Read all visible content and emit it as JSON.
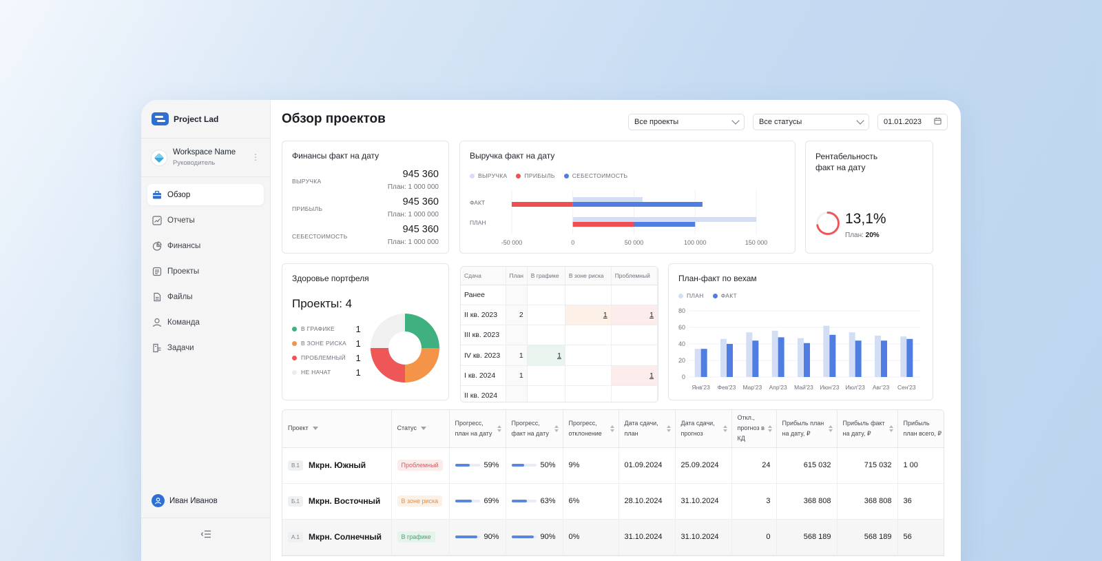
{
  "brand": {
    "name": "Project Lad"
  },
  "workspace": {
    "name": "Workspace Name",
    "role": "Руководитель"
  },
  "nav": [
    {
      "label": "Обзор",
      "icon": "briefcase-icon",
      "active": true
    },
    {
      "label": "Отчеты",
      "icon": "chart-line-icon"
    },
    {
      "label": "Финансы",
      "icon": "pie-chart-icon"
    },
    {
      "label": "Проекты",
      "icon": "document-icon"
    },
    {
      "label": "Файлы",
      "icon": "file-icon"
    },
    {
      "label": "Команда",
      "icon": "user-icon"
    },
    {
      "label": "Задачи",
      "icon": "tasks-icon"
    }
  ],
  "user": {
    "name": "Иван Иванов"
  },
  "page": {
    "title": "Обзор проектов"
  },
  "filters": {
    "projects": "Все проекты",
    "statuses": "Все статусы",
    "date": "01.01.2023"
  },
  "finance": {
    "title": "Финансы факт на дату",
    "rows": [
      {
        "label": "ВЫРУЧКА",
        "value": "945 360",
        "plan": "План: 1 000 000"
      },
      {
        "label": "ПРИБЫЛЬ",
        "value": "945 360",
        "plan": "План: 1 000 000"
      },
      {
        "label": "СЕБЕСТОИМОСТЬ",
        "value": "945 360",
        "plan": "План: 1 000 000"
      }
    ]
  },
  "revenue": {
    "title": "Выручка факт на дату",
    "legend": [
      "ВЫРУЧКА",
      "ПРИБЫЛЬ",
      "СЕБЕСТОИМОСТЬ"
    ],
    "row_labels": [
      "ФАКТ",
      "ПЛАН"
    ],
    "ticks": [
      "-50 000",
      "0",
      "50 000",
      "100 000",
      "150 000"
    ]
  },
  "profitability": {
    "title1": "Рентабельность",
    "title2": "факт на дату",
    "value": "13,1%",
    "plan_label": "План:",
    "plan_value": "20%",
    "fraction": 0.131
  },
  "health": {
    "title": "Здоровье портфеля",
    "total": "Проекты: 4",
    "items": [
      {
        "label": "В ГРАФИКЕ",
        "count": "1",
        "color": "#3fb07f"
      },
      {
        "label": "В ЗОНЕ РИСКА",
        "count": "1",
        "color": "#f39449"
      },
      {
        "label": "ПРОБЛЕМНЫЙ",
        "count": "1",
        "color": "#ef5658"
      },
      {
        "label": "НЕ НАЧАТ",
        "count": "1",
        "color": "#f0f0f0"
      }
    ]
  },
  "milestones_table": {
    "headers": [
      "Сдача",
      "План",
      "В графике",
      "В зоне риска",
      "Проблемный"
    ],
    "rows": [
      {
        "label": "Ранее",
        "plan": "",
        "ok": "",
        "risk": "",
        "bad": ""
      },
      {
        "label": "II кв. 2023",
        "plan": "2",
        "ok": "",
        "risk": "1",
        "bad": "1"
      },
      {
        "label": "III кв. 2023",
        "plan": "",
        "ok": "",
        "risk": "",
        "bad": ""
      },
      {
        "label": "IV кв. 2023",
        "plan": "1",
        "ok": "1",
        "risk": "",
        "bad": ""
      },
      {
        "label": "I кв. 2024",
        "plan": "1",
        "ok": "",
        "risk": "",
        "bad": "1"
      },
      {
        "label": "II кв. 2024",
        "plan": "",
        "ok": "",
        "risk": "",
        "bad": ""
      }
    ]
  },
  "milestones_chart": {
    "title": "План-факт по вехам",
    "legend": [
      "ПЛАН",
      "ФАКТ"
    ]
  },
  "chart_data": [
    {
      "type": "bar",
      "title": "Выручка факт на дату",
      "orientation": "horizontal",
      "categories": [
        "ФАКТ",
        "ПЛАН"
      ],
      "series": [
        {
          "name": "ВЫРУЧКА",
          "values": [
            57000,
            150000
          ],
          "color": "#d3def5"
        },
        {
          "name": "ПРИБЫЛЬ",
          "values": [
            -50000,
            50000
          ],
          "color": "#ef4f52"
        },
        {
          "name": "СЕБЕСТОИМОСТЬ",
          "values": [
            106000,
            100000
          ],
          "color": "#4f7ee0"
        }
      ],
      "xlim": [
        -50000,
        150000
      ],
      "x_ticks": [
        "-50 000",
        "0",
        "50 000",
        "100 000",
        "150 000"
      ]
    },
    {
      "type": "bar",
      "title": "План-факт по вехам",
      "categories": [
        "Янв'23",
        "Фев'23",
        "Мар'23",
        "Апр'23",
        "Май'23",
        "Июн'23",
        "Июл'23",
        "Авг'23",
        "Сен'23"
      ],
      "series": [
        {
          "name": "ПЛАН",
          "values": [
            34,
            46,
            54,
            56,
            47,
            62,
            54,
            50,
            49
          ],
          "color": "#d3def5"
        },
        {
          "name": "ФАКТ",
          "values": [
            34,
            40,
            44,
            48,
            41,
            51,
            44,
            44,
            46
          ],
          "color": "#4f7ee0"
        }
      ],
      "ylim": [
        0,
        80
      ],
      "y_ticks": [
        "0",
        "20",
        "40",
        "60",
        "80"
      ]
    },
    {
      "type": "pie",
      "title": "Здоровье портфеля",
      "labels": [
        "В ГРАФИКЕ",
        "В ЗОНЕ РИСКА",
        "ПРОБЛЕМНЫЙ",
        "НЕ НАЧАТ"
      ],
      "values": [
        1,
        1,
        1,
        1
      ]
    }
  ],
  "projects_table": {
    "headers": [
      "Проект",
      "Статус",
      "Прогресс, план на дату",
      "Прогресс, факт на дату",
      "Прогресс, отклонение",
      "Дата сдачи, план",
      "Дата сдачи, прогноз",
      "Откл., прогноз в КД",
      "Прибыль план на дату, ₽",
      "Прибыль факт на дату, ₽",
      "Прибыль план всего, ₽"
    ],
    "rows": [
      {
        "code": "В.1",
        "name": "Мкрн. Южный",
        "status": "Проблемный",
        "status_kind": "bad",
        "plan_pct": "59%",
        "plan_frac": 0.59,
        "fact_pct": "50%",
        "fact_frac": 0.5,
        "dev": "9%",
        "dev_red": true,
        "date_plan": "01.09.2024",
        "date_fc": "25.09.2024",
        "kd": "24",
        "kd_red": true,
        "p_plan": "615 032",
        "p_fact": "715 032",
        "p_fact_green": true,
        "p_total": "1 00"
      },
      {
        "code": "Б.1",
        "name": "Мкрн. Восточный",
        "status": "В зоне риска",
        "status_kind": "risk",
        "plan_pct": "69%",
        "plan_frac": 0.69,
        "fact_pct": "63%",
        "fact_frac": 0.63,
        "dev": "6%",
        "dev_red": true,
        "date_plan": "28.10.2024",
        "date_fc": "31.10.2024",
        "kd": "3",
        "kd_red": true,
        "p_plan": "368 808",
        "p_fact": "368 808",
        "p_fact_green": false,
        "p_total": "36"
      },
      {
        "code": "А.1",
        "name": "Мкрн. Солнечный",
        "status": "В графике",
        "status_kind": "good",
        "plan_pct": "90%",
        "plan_frac": 0.9,
        "fact_pct": "90%",
        "fact_frac": 0.9,
        "dev": "0%",
        "dev_red": false,
        "date_plan": "31.10.2024",
        "date_fc": "31.10.2024",
        "kd": "0",
        "kd_red": false,
        "p_plan": "568 189",
        "p_fact": "568 189",
        "p_fact_green": false,
        "p_total": "56"
      }
    ]
  }
}
